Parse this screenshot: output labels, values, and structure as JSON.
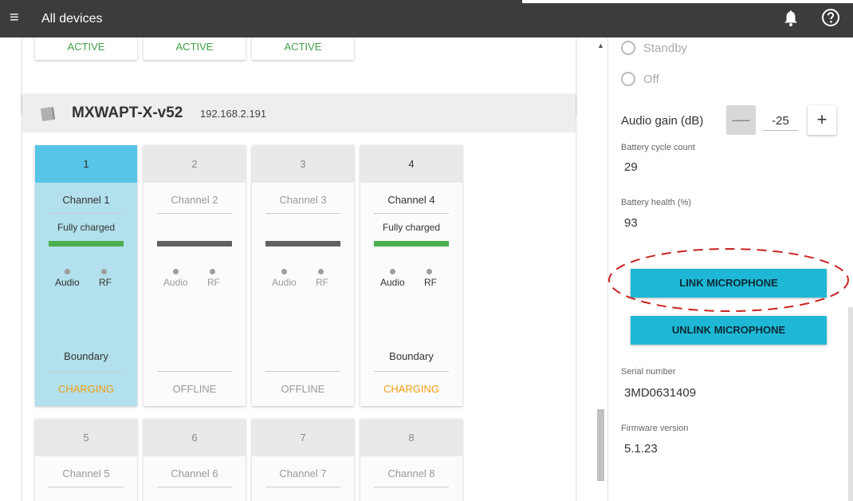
{
  "topbar": {
    "title": "All devices",
    "menu_icon": "≡"
  },
  "previous_device": {
    "status_labels": [
      "ACTIVE",
      "ACTIVE",
      "ACTIVE"
    ]
  },
  "device": {
    "name": "MXWAPT-X-v52",
    "ip": "192.168.2.191"
  },
  "channels": [
    {
      "num": "1",
      "name": "Channel 1",
      "status": "Fully charged",
      "bar": "green",
      "audio": "Audio",
      "rf": "RF",
      "type": "Boundary",
      "state": "CHARGING",
      "selected": true
    },
    {
      "num": "2",
      "name": "Channel 2",
      "status": "",
      "bar": "gray",
      "audio": "Audio",
      "rf": "RF",
      "type": "",
      "state": "OFFLINE",
      "selected": false
    },
    {
      "num": "3",
      "name": "Channel 3",
      "status": "",
      "bar": "gray",
      "audio": "Audio",
      "rf": "RF",
      "type": "",
      "state": "OFFLINE",
      "selected": false
    },
    {
      "num": "4",
      "name": "Channel 4",
      "status": "Fully charged",
      "bar": "green",
      "audio": "Audio",
      "rf": "RF",
      "type": "Boundary",
      "state": "CHARGING",
      "selected": false
    },
    {
      "num": "5",
      "name": "Channel 5"
    },
    {
      "num": "6",
      "name": "Channel 6"
    },
    {
      "num": "7",
      "name": "Channel 7"
    },
    {
      "num": "8",
      "name": "Channel 8"
    }
  ],
  "panel": {
    "radio_standby": "Standby",
    "radio_off": "Off",
    "audio_gain_label": "Audio gain (dB)",
    "minus": "—",
    "plus": "+",
    "audio_gain_value": "-25",
    "battery_cycle_label": "Battery cycle count",
    "battery_cycle_value": "29",
    "battery_health_label": "Battery health (%)",
    "battery_health_value": "93",
    "link_button": "LINK MICROPHONE",
    "unlink_button": "UNLINK MICROPHONE",
    "serial_label": "Serial number",
    "serial_value": "3MD0631409",
    "firmware_label": "Firmware version",
    "firmware_value": "5.1.23"
  },
  "colors": {
    "accent": "#1eb8d6",
    "selected_channel": "#b2e0ec",
    "charging": "#f39c12",
    "active": "#43a047",
    "highlight": "#cc2222"
  }
}
